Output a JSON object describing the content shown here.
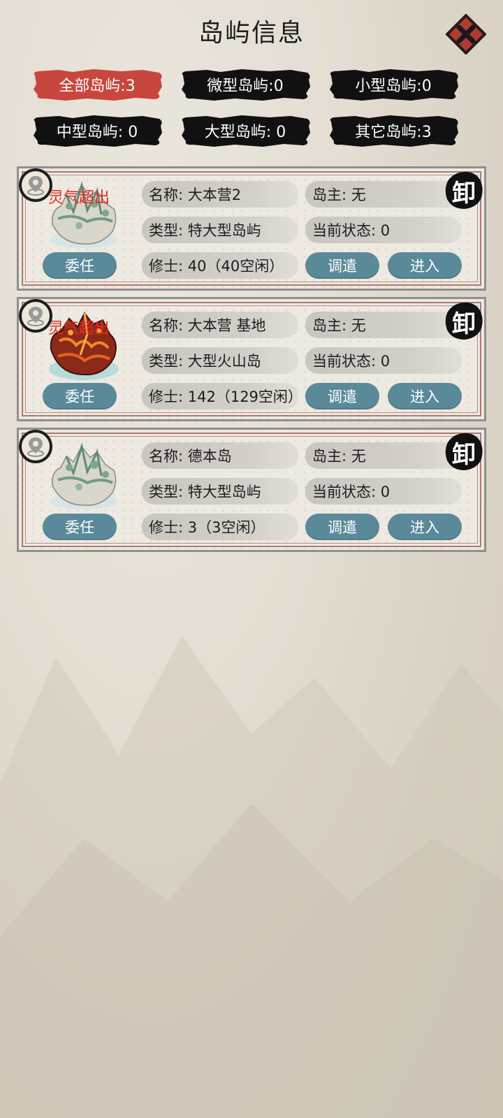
{
  "title": "岛屿信息",
  "filters": [
    {
      "label": "全部岛屿:3",
      "active": true
    },
    {
      "label": "微型岛屿:0",
      "active": false
    },
    {
      "label": "小型岛屿:0",
      "active": false
    },
    {
      "label": "中型岛屿: 0",
      "active": false
    },
    {
      "label": "大型岛屿: 0",
      "active": false
    },
    {
      "label": "其它岛屿:3",
      "active": false
    }
  ],
  "islands": [
    {
      "name": "名称: 大本营2",
      "owner": "岛主: 无",
      "type": "类型: 特大型岛屿",
      "status": "当前状态: 0",
      "cultivators": "修士: 40（40空闲）",
      "overflow_note": "灵气超出",
      "seal": "卸",
      "appoint_label": "委任",
      "dispatch_label": "调遣",
      "enter_label": "进入",
      "terrain": "green-mountain"
    },
    {
      "name": "名称: 大本营   基地",
      "owner": "岛主: 无",
      "type": "类型: 大型火山岛",
      "status": "当前状态: 0",
      "cultivators": "修士: 142（129空闲）",
      "overflow_note": "灵气超出",
      "seal": "卸",
      "appoint_label": "委任",
      "dispatch_label": "调遣",
      "enter_label": "进入",
      "terrain": "volcano"
    },
    {
      "name": "名称: 德本岛",
      "owner": "岛主: 无",
      "type": "类型: 特大型岛屿",
      "status": "当前状态: 0",
      "cultivators": "修士: 3（3空闲）",
      "overflow_note": "",
      "seal": "卸",
      "appoint_label": "委任",
      "dispatch_label": "调遣",
      "enter_label": "进入",
      "terrain": "green-mountain"
    }
  ],
  "colors": {
    "active_filter": "#c8463e",
    "inactive_filter": "#111111",
    "action_button": "#5a8a9a",
    "warning_text": "#e52a1f"
  }
}
